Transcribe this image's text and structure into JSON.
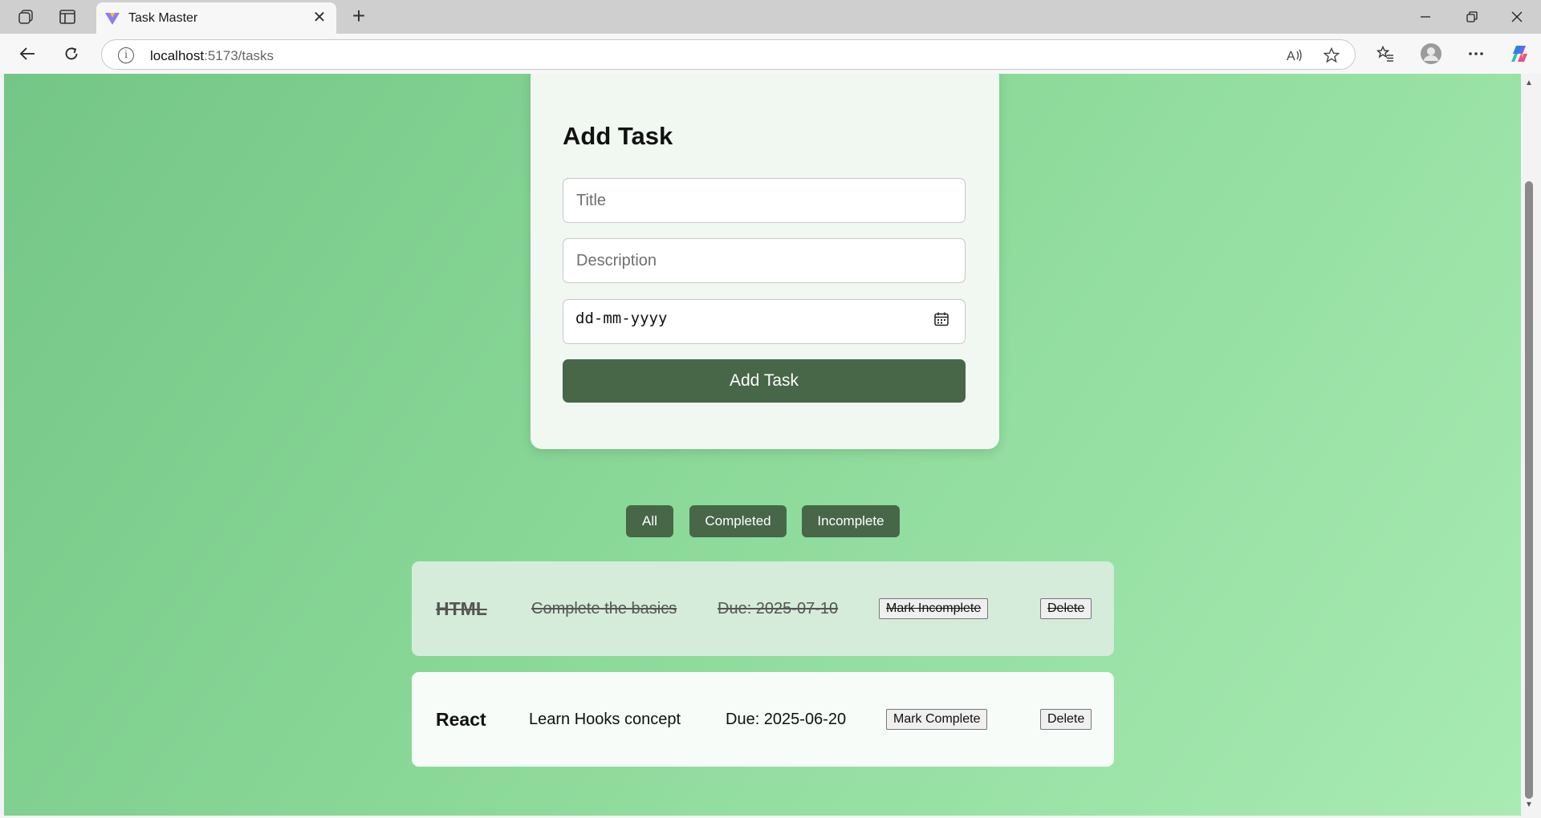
{
  "browser": {
    "tab_title": "Task Master",
    "tab_close": "✕",
    "new_tab": "+",
    "url_host": "localhost",
    "url_path": ":5173/tasks",
    "icons": [
      "workspaces-icon",
      "tab-actions-icon",
      "back-icon",
      "refresh-icon",
      "read-aloud-icon",
      "favorite-star-icon",
      "favorites-icon",
      "profile-icon",
      "more-icon",
      "copilot-icon"
    ]
  },
  "form": {
    "heading": "Add Task",
    "title_placeholder": "Title",
    "description_placeholder": "Description",
    "date_placeholder": "dd-mm-yyyy",
    "submit_label": "Add Task"
  },
  "filters": {
    "all": "All",
    "completed": "Completed",
    "incomplete": "Incomplete"
  },
  "tasks": [
    {
      "title": "HTML",
      "description": "Complete the basics",
      "due": "Due: 2025-07-10",
      "completed": true,
      "toggle_label": "Mark Incomplete",
      "delete_label": "Delete"
    },
    {
      "title": "React",
      "description": "Learn Hooks concept",
      "due": "Due: 2025-06-20",
      "completed": false,
      "toggle_label": "Mark Complete",
      "delete_label": "Delete"
    }
  ],
  "colors": {
    "primary_button": "#476748",
    "completed_card": "#d4ecd9",
    "open_card": "#f7fcf8",
    "background_start": "#74c687",
    "background_end": "#a8ebb3"
  }
}
